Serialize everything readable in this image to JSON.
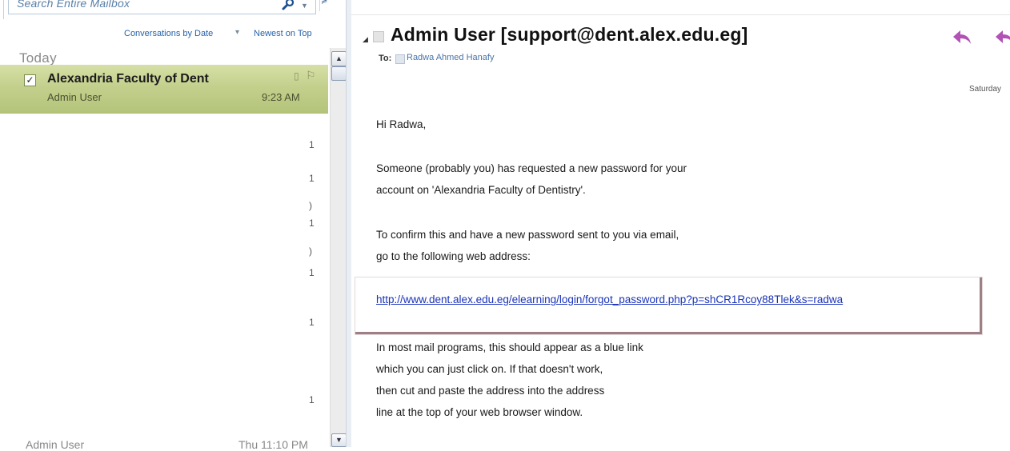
{
  "search": {
    "placeholder": "Search Entire Mailbox"
  },
  "sort": {
    "by_label": "Conversations by Date",
    "order_label": "Newest on Top"
  },
  "list": {
    "group_today": "Today",
    "selected_item": {
      "subject": "Alexandria Faculty of Dent",
      "sender": "Admin User",
      "time": "9:23 AM",
      "checked": true
    },
    "truncated_markers": [
      "1",
      "1",
      ")",
      "1",
      ")",
      "1",
      "1",
      "1"
    ],
    "bottom_item": {
      "sender": "Admin User",
      "time": "Thu 11:10 PM"
    }
  },
  "message": {
    "sender_heading": "Admin User [support@dent.alex.edu.eg]",
    "to_label": "To:",
    "recipient": "Radwa Ahmed Hanafy",
    "date": "Saturday",
    "body": {
      "greeting": "Hi Radwa,",
      "p1_line1": "Someone (probably you) has requested a new password for your",
      "p1_line2": "account on 'Alexandria Faculty of Dentistry'.",
      "p2_line1": "To confirm this and have a new password sent to you via email,",
      "p2_line2": "go to the following web address:",
      "link": "http://www.dent.alex.edu.eg/elearning/login/forgot_password.php?p=shCR1Rcoy88Tlek&s=radwa",
      "p3_line1": "In most mail programs, this should appear as a blue link",
      "p3_line2": "which you can just click on.  If that doesn't work,",
      "p3_line3": "then cut and paste the address into the address",
      "p3_line4": "line at the top of your web browser window."
    }
  },
  "icons": {
    "search": "search-icon",
    "reply": "reply-icon",
    "reply_all": "reply-all-icon",
    "flag": "flag-icon"
  },
  "colors": {
    "selected_row": "#c3d08d",
    "link": "#1a33b8",
    "reply_icon": "#b153b5",
    "accent_blue": "#2862a8"
  }
}
